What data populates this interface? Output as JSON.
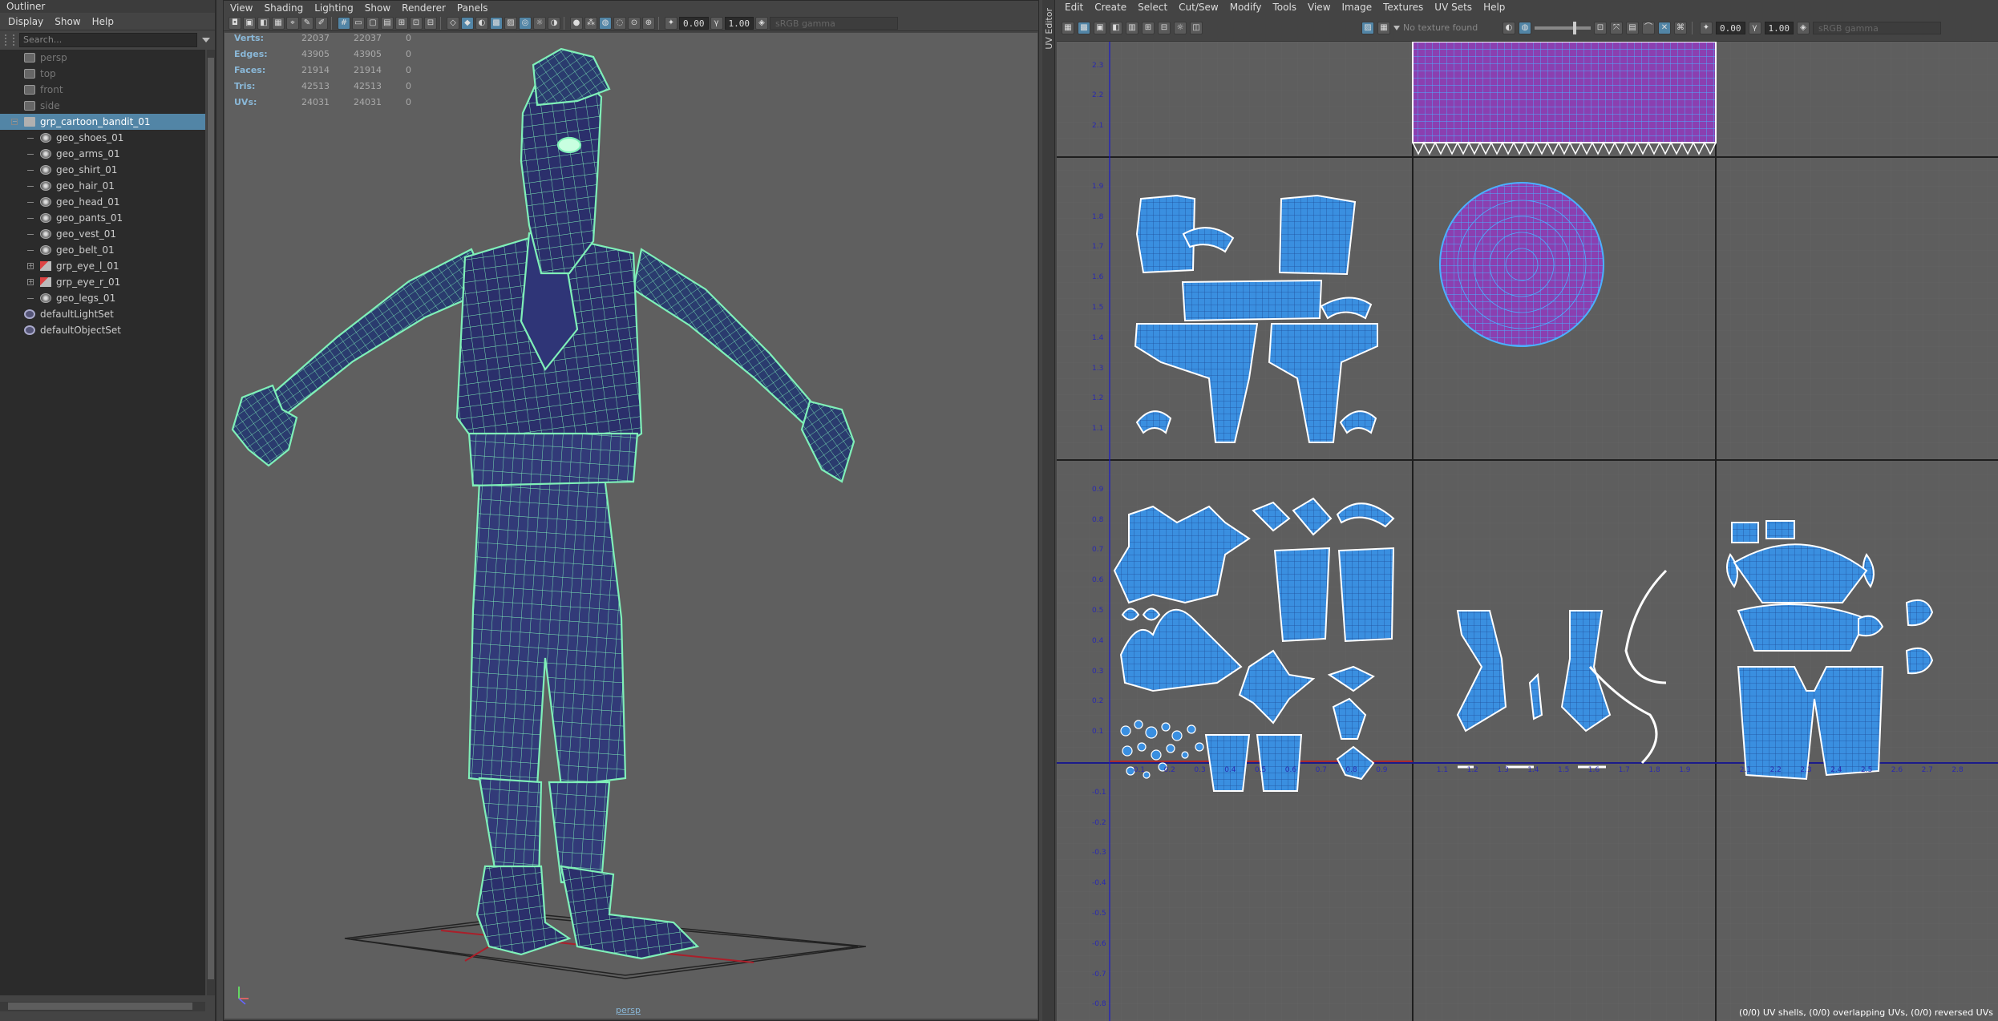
{
  "outliner": {
    "title": "Outliner",
    "menu": [
      "Display",
      "Show",
      "Help"
    ],
    "search_placeholder": "Search...",
    "items": [
      {
        "label": "persp",
        "type": "camera",
        "dim": true
      },
      {
        "label": "top",
        "type": "camera",
        "dim": true
      },
      {
        "label": "front",
        "type": "camera",
        "dim": true
      },
      {
        "label": "side",
        "type": "camera",
        "dim": true
      },
      {
        "label": "grp_cartoon_bandit_01",
        "type": "group",
        "selected": true
      },
      {
        "label": "geo_shoes_01",
        "type": "mesh",
        "child": true
      },
      {
        "label": "geo_arms_01",
        "type": "mesh",
        "child": true
      },
      {
        "label": "geo_shirt_01",
        "type": "mesh",
        "child": true
      },
      {
        "label": "geo_hair_01",
        "type": "mesh",
        "child": true
      },
      {
        "label": "geo_head_01",
        "type": "mesh",
        "child": true
      },
      {
        "label": "geo_pants_01",
        "type": "mesh",
        "child": true
      },
      {
        "label": "geo_vest_01",
        "type": "mesh",
        "child": true
      },
      {
        "label": "geo_belt_01",
        "type": "mesh",
        "child": true
      },
      {
        "label": "grp_eye_l_01",
        "type": "eyegroup",
        "child": true
      },
      {
        "label": "grp_eye_r_01",
        "type": "eyegroup",
        "child": true
      },
      {
        "label": "geo_legs_01",
        "type": "mesh",
        "child": true
      },
      {
        "label": "defaultLightSet",
        "type": "set"
      },
      {
        "label": "defaultObjectSet",
        "type": "set"
      }
    ]
  },
  "viewport": {
    "menu": [
      "View",
      "Shading",
      "Lighting",
      "Show",
      "Renderer",
      "Panels"
    ],
    "exposure": "0.00",
    "gamma": "1.00",
    "color_space": "sRGB gamma",
    "hud": [
      {
        "key": "Verts:",
        "v1": "22037",
        "v2": "22037",
        "v3": "0"
      },
      {
        "key": "Edges:",
        "v1": "43905",
        "v2": "43905",
        "v3": "0"
      },
      {
        "key": "Faces:",
        "v1": "21914",
        "v2": "21914",
        "v3": "0"
      },
      {
        "key": "Tris:",
        "v1": "42513",
        "v2": "42513",
        "v3": "0"
      },
      {
        "key": "UVs:",
        "v1": "24031",
        "v2": "24031",
        "v3": "0"
      }
    ],
    "camera_label": "persp",
    "colors": {
      "wire": "#7ff0b8",
      "mesh": "#2b2f6b",
      "bg": "#5f5f5f"
    }
  },
  "uv_editor": {
    "side_title": "UV Editor",
    "menu": [
      "Edit",
      "Create",
      "Select",
      "Cut/Sew",
      "Modify",
      "Tools",
      "View",
      "Image",
      "Textures",
      "UV Sets",
      "Help"
    ],
    "texture_status": "No texture found",
    "exposure": "0.00",
    "gamma": "1.00",
    "color_space": "sRGB gamma",
    "status": "(0/0) UV shells, (0/0) overlapping UVs, (0/0) reversed UVs",
    "axis_labels_u": [
      "0.1",
      "0.2",
      "0.3",
      "0.4",
      "0.5",
      "0.6",
      "0.7",
      "0.8",
      "0.9",
      "1.1",
      "1.2",
      "1.3",
      "1.4",
      "1.5",
      "1.6",
      "1.7",
      "1.8",
      "1.9",
      "2.1",
      "2.2",
      "2.3",
      "2.4",
      "2.5",
      "2.6",
      "2.7",
      "2.8"
    ],
    "axis_labels_v": [
      "2.3",
      "2.2",
      "2.1",
      "1.9",
      "1.8",
      "1.7",
      "1.6",
      "1.5",
      "1.4",
      "1.3",
      "1.2",
      "1.1",
      "0.9",
      "0.8",
      "0.7",
      "0.6",
      "0.5",
      "0.4",
      "0.3",
      "0.2",
      "0.1",
      "-0.1",
      "-0.2",
      "-0.3",
      "-0.4",
      "-0.5",
      "-0.6",
      "-0.7",
      "-0.8"
    ],
    "colors": {
      "shell": "#3a8fe0",
      "shell_edge": "#ffffff",
      "magenta": "#8b3fb0"
    }
  }
}
